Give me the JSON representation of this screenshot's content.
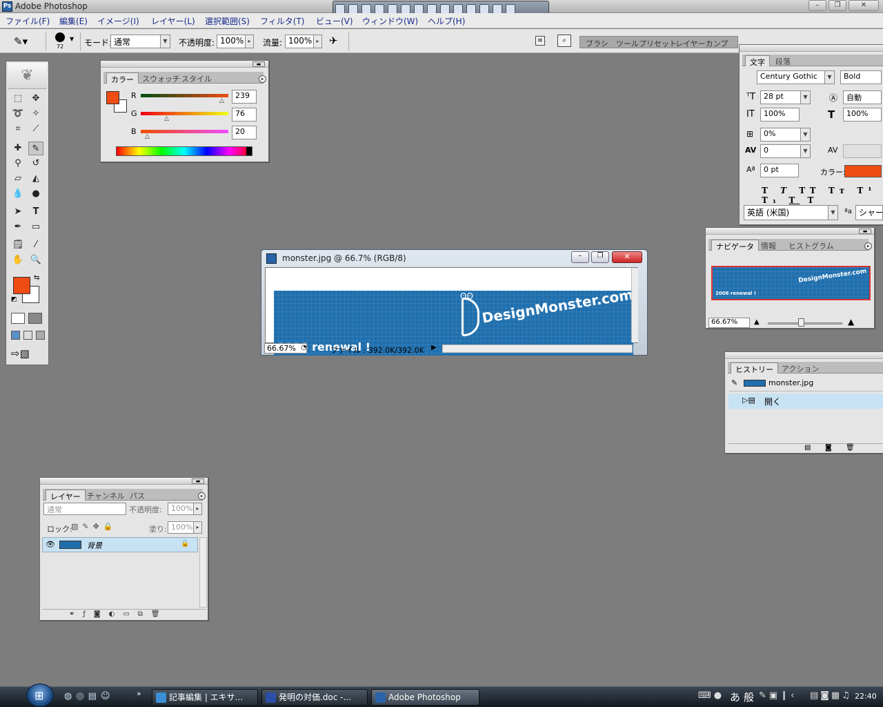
{
  "window": {
    "title": "Adobe Photoshop"
  },
  "menubar": [
    "ファイル(F)",
    "編集(E)",
    "イメージ(I)",
    "レイヤー(L)",
    "選択範囲(S)",
    "フィルタ(T)",
    "ビュー(V)",
    "ウィンドウ(W)",
    "ヘルプ(H)"
  ],
  "options": {
    "brush_size": "72",
    "mode_label": "モード:",
    "mode_value": "通常",
    "opacity_label": "不透明度:",
    "opacity_value": "100%",
    "flow_label": "流量:",
    "flow_value": "100%",
    "well_tabs": [
      "ブラシ",
      "ツールプリセット",
      "レイヤーカンプ"
    ]
  },
  "color_panel": {
    "tabs": [
      "カラー",
      "スウォッチ",
      "スタイル"
    ],
    "r_label": "R",
    "g_label": "G",
    "b_label": "B",
    "r": "239",
    "g": "76",
    "b": "20",
    "fg_color": "#ef4c14"
  },
  "toolbox": {
    "fg_color": "#ef4c14",
    "bg_color": "#ffffff"
  },
  "character_panel": {
    "tabs": [
      "文字",
      "段落"
    ],
    "font_family": "Century Gothic",
    "font_style": "Bold",
    "font_size": "28 pt",
    "leading": "自動",
    "vertical_scale": "100%",
    "horizontal_scale": "100%",
    "tsume": "0%",
    "tracking": "0",
    "baseline_shift": "0 pt",
    "color_label": "カラー:",
    "color": "#ef4c14",
    "language": "英語 (米国)",
    "aa_value": "シャープ"
  },
  "navigator_panel": {
    "tabs": [
      "ナビゲータ",
      "情報",
      "ヒストグラム"
    ],
    "zoom": "66.67%",
    "thumb_text": "DesignMonster.com",
    "thumb_caption": "2006 renewal !"
  },
  "document": {
    "title": "monster.jpg @ 66.7% (RGB/8)",
    "zoom": "66.67%",
    "file_info": "ファイル : 392.0K/392.0K",
    "banner_logo": "DesignMonster.com",
    "banner_caption": "2006 renewal !",
    "banner_color": "#1f6fae"
  },
  "history_panel": {
    "tabs": [
      "ヒストリー",
      "アクション"
    ],
    "snapshot": "monster.jpg",
    "states": [
      "開く"
    ]
  },
  "layers_panel": {
    "tabs": [
      "レイヤー",
      "チャンネル",
      "パス"
    ],
    "blend_mode": "通常",
    "opacity_label": "不透明度:",
    "opacity": "100%",
    "lock_label": "ロック:",
    "fill_label": "塗り:",
    "fill": "100%",
    "layers": [
      "背景"
    ]
  },
  "taskbar": {
    "buttons": [
      "記事編集 | エキサ...",
      "発明の対価.doc -...",
      "Adobe Photoshop"
    ],
    "ime": [
      "あ",
      "般"
    ],
    "clock": "22:40"
  }
}
